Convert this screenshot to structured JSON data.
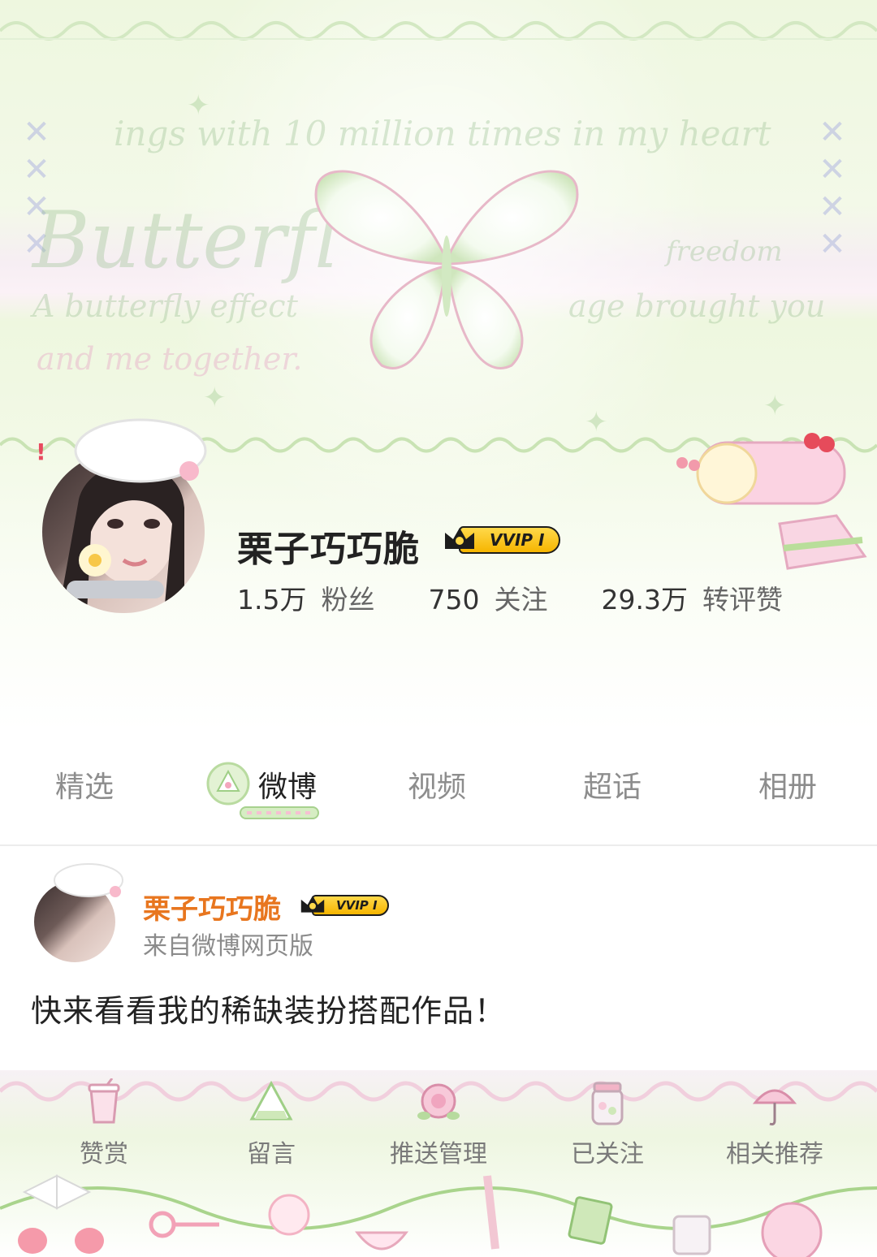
{
  "profile": {
    "username": "栗子巧巧脆",
    "vip_badge": "VVIP I",
    "stats": [
      {
        "num": "1.5万",
        "label": "粉丝"
      },
      {
        "num": "750",
        "label": "关注"
      },
      {
        "num": "29.3万",
        "label": "转评赞"
      }
    ]
  },
  "banner": {
    "script_lines": [
      "Butterfl",
      "A butterfly effect",
      "and me together.",
      "ings with 10 million times in my heart",
      "freedom",
      "age brought you"
    ]
  },
  "tabs": [
    {
      "label": "精选",
      "active": false
    },
    {
      "label": "微博",
      "active": true
    },
    {
      "label": "视频",
      "active": false
    },
    {
      "label": "超话",
      "active": false
    },
    {
      "label": "相册",
      "active": false
    }
  ],
  "post": {
    "username": "栗子巧巧脆",
    "vip_badge": "VVIP I",
    "source": "来自微博网页版",
    "body": "快来看看我的稀缺装扮搭配作品！"
  },
  "bottom_bar": [
    {
      "label": "赞赏",
      "icon": "juice-cup-icon"
    },
    {
      "label": "留言",
      "icon": "rice-ball-icon"
    },
    {
      "label": "推送管理",
      "icon": "rose-icon"
    },
    {
      "label": "已关注",
      "icon": "jar-icon"
    },
    {
      "label": "相关推荐",
      "icon": "umbrella-icon"
    }
  ],
  "colors": {
    "accent_username": "#e8761f",
    "vip_gold": "#f6b500",
    "banner_green": "#eef7df",
    "banner_pink": "#fbf1f6"
  }
}
